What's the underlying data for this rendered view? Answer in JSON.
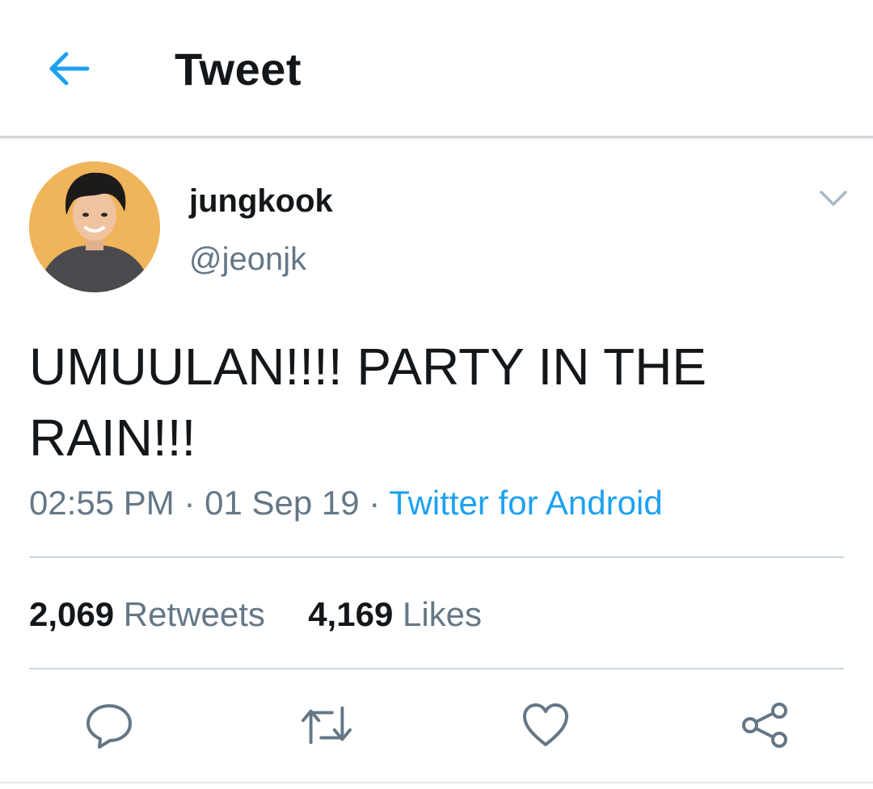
{
  "header": {
    "title": "Tweet",
    "back_icon": "arrow-left-icon",
    "accent_color": "#1da1f2"
  },
  "tweet": {
    "author": {
      "display_name": "jungkook",
      "handle": "@jeonjk",
      "avatar_background": "#f0b45a"
    },
    "text_line1": "UMUULAN!!!! PARTY IN THE",
    "text_line2": "RAIN!!!",
    "time": "02:55 PM",
    "separator": " · ",
    "date": "01 Sep 19",
    "source": "Twitter for Android",
    "caret_icon": "chevron-down-icon"
  },
  "stats": {
    "retweets_count": "2,069",
    "retweets_label": "Retweets",
    "likes_count": "4,169",
    "likes_label": "Likes"
  },
  "actions": [
    {
      "name": "reply",
      "icon": "reply-icon"
    },
    {
      "name": "retweet",
      "icon": "retweet-icon"
    },
    {
      "name": "like",
      "icon": "heart-icon"
    },
    {
      "name": "share",
      "icon": "share-icon"
    }
  ],
  "colors": {
    "text_primary": "#14171a",
    "text_secondary": "#657786",
    "link": "#1da1f2",
    "divider": "#ccd6dd"
  }
}
